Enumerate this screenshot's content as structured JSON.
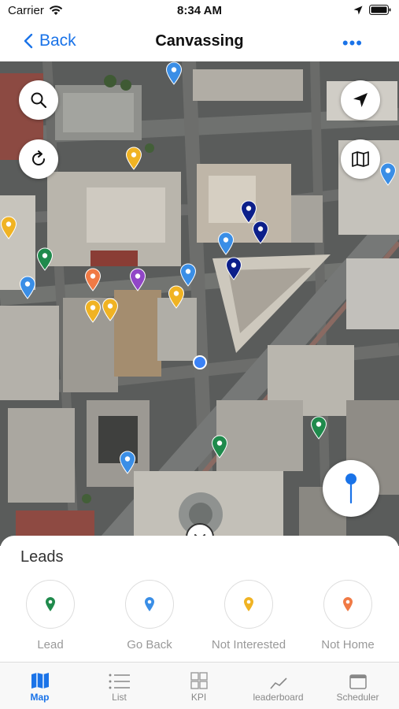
{
  "status_bar": {
    "carrier": "Carrier",
    "time": "8:34 AM"
  },
  "nav": {
    "back_label": "Back",
    "title": "Canvassing",
    "more_label": "•••"
  },
  "map": {
    "pin_colors": {
      "blue": "#3a8ee6",
      "yellow": "#f0b323",
      "green": "#1f8a4c",
      "orange": "#f07a45",
      "purple": "#9146c7",
      "navy": "#0c1f8a"
    }
  },
  "leads": {
    "heading": "Leads",
    "items": [
      {
        "label": "Lead",
        "color": "#1f8a4c"
      },
      {
        "label": "Go Back",
        "color": "#3a8ee6"
      },
      {
        "label": "Not Interested",
        "color": "#f0b323"
      },
      {
        "label": "Not Home",
        "color": "#f07a45"
      }
    ]
  },
  "tabs": [
    {
      "label": "Map",
      "icon": "map-icon",
      "active": true
    },
    {
      "label": "List",
      "icon": "list-icon",
      "active": false
    },
    {
      "label": "KPI",
      "icon": "kpi-icon",
      "active": false
    },
    {
      "label": "leaderboard",
      "icon": "leaderboard-icon",
      "active": false
    },
    {
      "label": "Scheduler",
      "icon": "calendar-icon",
      "active": false
    }
  ]
}
